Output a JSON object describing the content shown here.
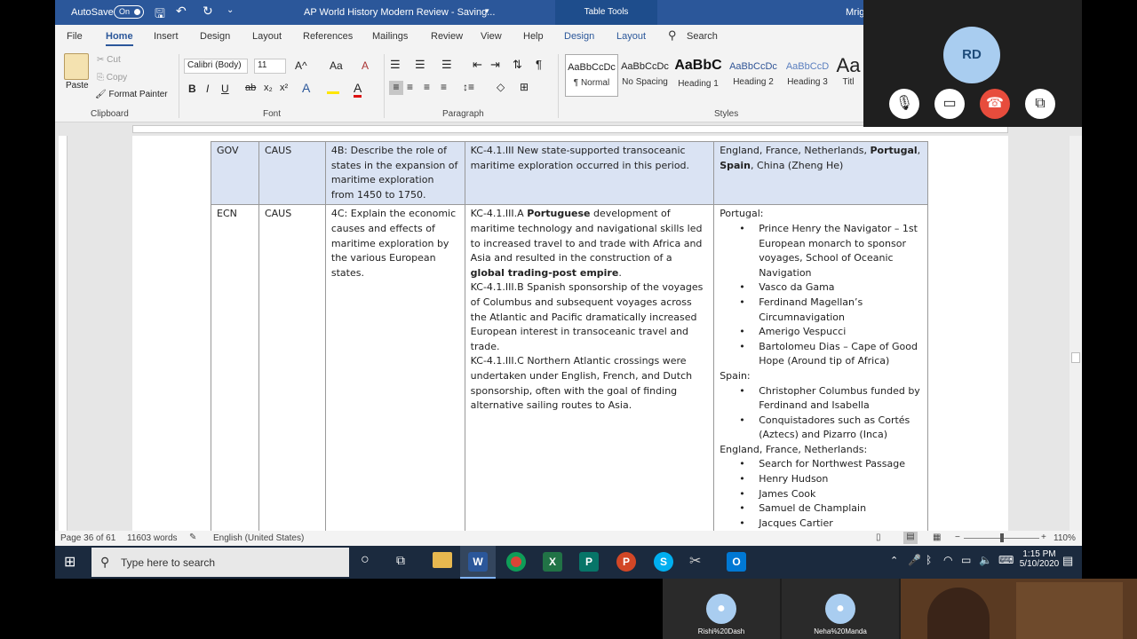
{
  "title_bar": {
    "autosave_label": "AutoSave",
    "autosave_state": "On",
    "doc_title": "AP World History Modern Review - Saving...",
    "context_tab": "Table Tools",
    "user_partial": "Mrig"
  },
  "ribbon_tabs": [
    "File",
    "Home",
    "Insert",
    "Design",
    "Layout",
    "References",
    "Mailings",
    "Review",
    "View",
    "Help",
    "Design",
    "Layout"
  ],
  "search_label": "Search",
  "clipboard": {
    "paste": "Paste",
    "cut": "Cut",
    "copy": "Copy",
    "format_painter": "Format Painter",
    "group": "Clipboard"
  },
  "font": {
    "name": "Calibri (Body)",
    "size": "11",
    "group": "Font"
  },
  "paragraph": {
    "group": "Paragraph"
  },
  "styles": {
    "group": "Styles",
    "items": [
      {
        "preview": "AaBbCcDc",
        "name": "¶ Normal"
      },
      {
        "preview": "AaBbCcDc",
        "name": "No Spacing"
      },
      {
        "preview": "AaBbC",
        "name": "Heading 1"
      },
      {
        "preview": "AaBbCcDc",
        "name": "Heading 2"
      },
      {
        "preview": "AaBbCcD",
        "name": "Heading 3"
      },
      {
        "preview": "Aa",
        "name": "Titl"
      }
    ]
  },
  "table": {
    "row1": {
      "c1": "GOV",
      "c2": "CAUS",
      "c3": "4B: Describe the role of states in the expansion of maritime exploration from 1450 to 1750.",
      "c4": "KC-4.1.III New state-supported transoceanic maritime exploration occurred in this period.",
      "c5_a": "England, France, Netherlands, ",
      "c5_b": "Portugal",
      "c5_c": ", ",
      "c5_d": "Spain",
      "c5_e": ", China (Zheng He)"
    },
    "row2": {
      "c1": "ECN",
      "c2": "CAUS",
      "c3": "4C: Explain the economic causes and effects of maritime exploration by the various European states.",
      "c4_p1_a": "KC-4.1.III.A ",
      "c4_p1_b": "Portuguese",
      "c4_p1_c": " development of maritime technology and navigational skills led to increased travel to and trade with Africa and Asia and resulted in the construction of a ",
      "c4_p1_d": "global trading-post empire",
      "c4_p1_e": ".",
      "c4_p2": "KC-4.1.III.B Spanish sponsorship of the voyages of Columbus and subsequent voyages across the Atlantic and Pacific dramatically increased European interest in transoceanic travel and trade.",
      "c4_p3": "KC-4.1.III.C Northern Atlantic crossings were undertaken under English, French, and Dutch sponsorship, often with the goal of finding alternative sailing routes to Asia.",
      "portugal_heading": "Portugal:",
      "portugal_items": [
        "Prince Henry the Navigator – 1st European monarch to sponsor voyages, School of Oceanic Navigation",
        "Vasco da Gama",
        "Ferdinand Magellan’s Circumnavigation",
        "Amerigo Vespucci",
        "Bartolomeu Dias – Cape of Good Hope (Around tip of Africa)"
      ],
      "spain_heading": "Spain:",
      "spain_items": [
        "Christopher Columbus funded by Ferdinand and Isabella",
        "Conquistadores such as Cortés (Aztecs) and Pizarro (Inca)"
      ],
      "efn_heading": "England, France, Netherlands:",
      "efn_items": [
        "Search for Northwest Passage",
        "Henry Hudson",
        "James Cook",
        "Samuel de Champlain",
        "Jacques Cartier"
      ]
    }
  },
  "status": {
    "page": "Page 36 of 61",
    "words": "11603 words",
    "language": "English (United States)",
    "zoom": "110%"
  },
  "taskbar": {
    "search_placeholder": "Type here to search",
    "time": "1:15 PM",
    "date": "5/10/2020"
  },
  "call": {
    "initials": "RD",
    "participants": [
      "Rishi%20Dash",
      "Neha%20Manda"
    ]
  },
  "colors": {
    "word_blue": "#2b579a",
    "header_row": "#dae3f3",
    "end_call": "#e74c3c"
  }
}
